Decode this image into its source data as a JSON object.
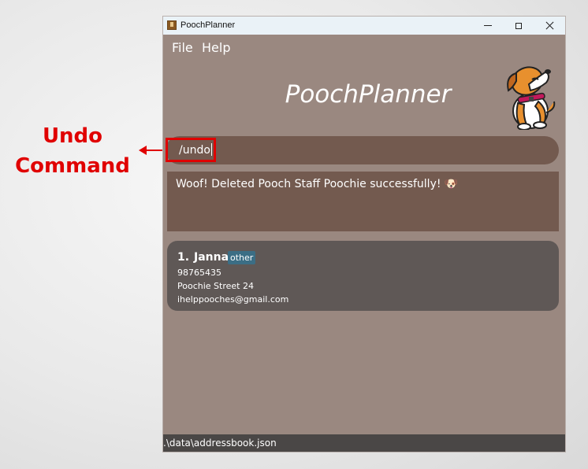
{
  "annotation": {
    "label_line1": "Undo",
    "label_line2": "Command",
    "color": "#e00000"
  },
  "window": {
    "title": "PoochPlanner",
    "controls": [
      "minimize-icon",
      "maximize-icon",
      "close-icon"
    ]
  },
  "menu": {
    "items": [
      {
        "label": "File"
      },
      {
        "label": "Help"
      }
    ]
  },
  "header": {
    "app_title": "PoochPlanner",
    "mascot": "dog-mascot-icon"
  },
  "command": {
    "value": "/undo"
  },
  "result": {
    "message": "Woof! Deleted Pooch Staff Poochie successfully! 🐶"
  },
  "persons": [
    {
      "index": "1.",
      "name": "Janna",
      "tag": "other",
      "phone": "98765435",
      "address": "Poochie Street 24",
      "email": "ihelppooches@gmail.com"
    }
  ],
  "status": {
    "path": ".\\data\\addressbook.json"
  },
  "colors": {
    "background": "#9a8880",
    "panel": "#735a4f",
    "card": "#5f5856",
    "tag": "#3b6e85",
    "statusbar": "#4a4746"
  }
}
